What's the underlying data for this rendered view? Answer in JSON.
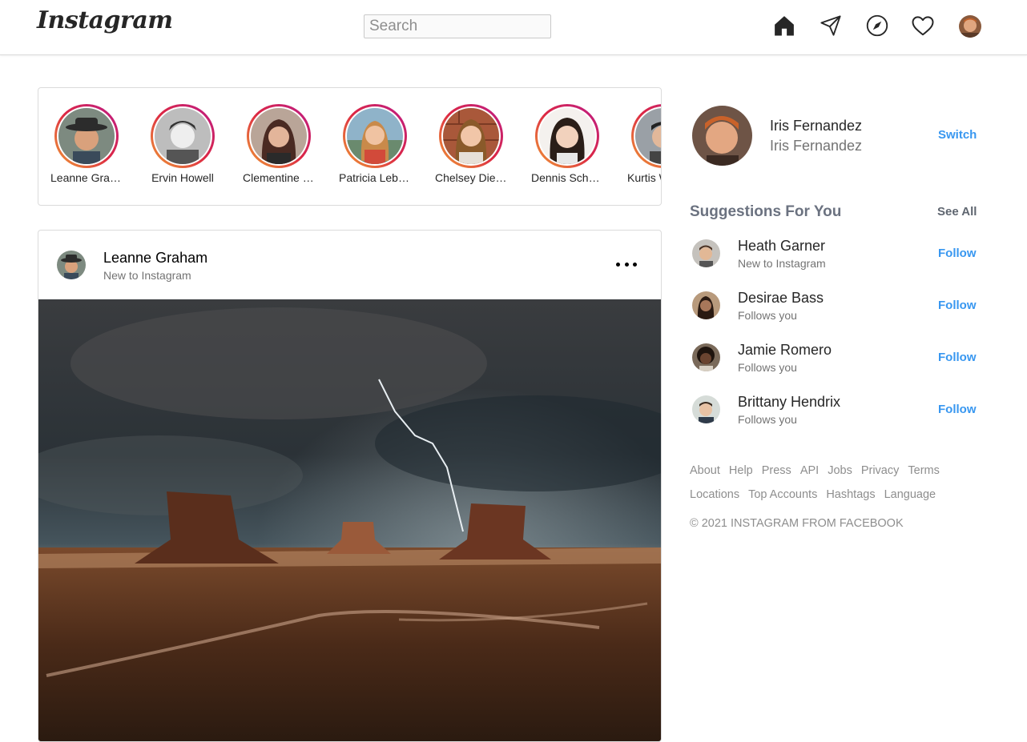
{
  "header": {
    "logo": "Instagram",
    "search_placeholder": "Search",
    "icons": [
      "home-icon",
      "direct-message-icon",
      "explore-icon",
      "activity-heart-icon",
      "profile-avatar"
    ]
  },
  "stories": [
    {
      "name": "Leanne Graham"
    },
    {
      "name": "Ervin Howell"
    },
    {
      "name": "Clementine Bauch"
    },
    {
      "name": "Patricia Lebsack"
    },
    {
      "name": "Chelsey Dietrich"
    },
    {
      "name": "Dennis Schulist"
    },
    {
      "name": "Kurtis Weissnat"
    }
  ],
  "post": {
    "username": "Leanne Graham",
    "subtitle": "New to Instagram"
  },
  "sidebar": {
    "profile": {
      "name": "Iris Fernandez",
      "username": "Iris Fernandez",
      "switch_label": "Switch"
    },
    "suggestions_title": "Suggestions For You",
    "see_all_label": "See All",
    "suggestions": [
      {
        "name": "Heath Garner",
        "subtitle": "New to Instagram",
        "action": "Follow"
      },
      {
        "name": "Desirae Bass",
        "subtitle": "Follows you",
        "action": "Follow"
      },
      {
        "name": "Jamie Romero",
        "subtitle": "Follows you",
        "action": "Follow"
      },
      {
        "name": "Brittany Hendrix",
        "subtitle": "Follows you",
        "action": "Follow"
      }
    ],
    "footer_links_row1": [
      "About",
      "Help",
      "Press",
      "API",
      "Jobs",
      "Privacy",
      "Terms"
    ],
    "footer_links_row2": [
      "Locations",
      "Top Accounts",
      "Hashtags",
      "Language"
    ],
    "copyright": "© 2021 INSTAGRAM FROM FACEBOOK"
  },
  "colors": {
    "accent": "#3897f0",
    "border": "#dbdbdb",
    "story_ring_start": "#f09433",
    "story_ring_end": "#bc1888"
  }
}
